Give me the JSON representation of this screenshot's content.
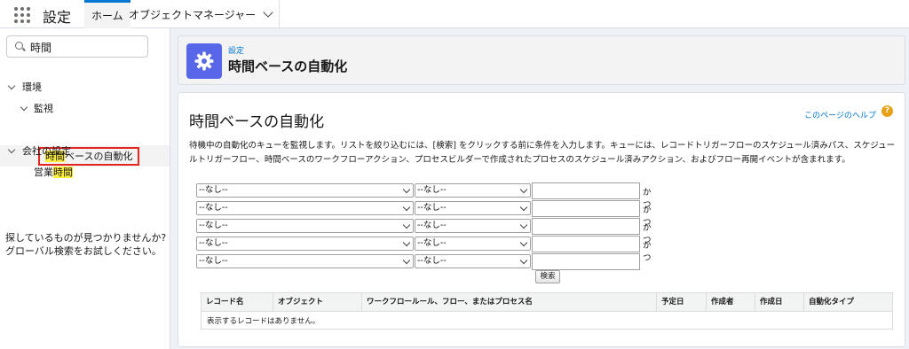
{
  "topbar": {
    "app_title": "設定",
    "tabs": [
      {
        "label": "ホーム",
        "active": true
      },
      {
        "label": "オブジェクトマネージャー",
        "active": false
      }
    ]
  },
  "sidebar": {
    "search": {
      "value": "時間",
      "placeholder": ""
    },
    "tree": {
      "env": "環境",
      "monitor": "監視",
      "selected": {
        "before": "時間",
        "after": "ベースの自動化"
      },
      "company": "会社の設定",
      "business": {
        "before": "営業",
        "match": "時間"
      }
    },
    "help": [
      "探しているものが見つかりませんか?",
      "グローバル検索をお試しください。"
    ]
  },
  "header": {
    "breadcrumb": "設定",
    "title": "時間ベースの自動化"
  },
  "content": {
    "title": "時間ベースの自動化",
    "help_link": "このページのヘルプ",
    "help_icon": "?",
    "description": "待機中の自動化のキューを監視します。リストを絞り込むには、[検索] をクリックする前に条件を入力します。キューには、レコードトリガーフローのスケジュール済みパス、スケジュールトリガーフロー、時間ベースのワークフローアクション、プロセスビルダーで作成されたプロセスのスケジュール済みアクション、およびフロー再開イベントが含まれます。",
    "filters": [
      {
        "field": "--なし--",
        "operator": "--なし--",
        "value": "",
        "conj": "かつ"
      },
      {
        "field": "--なし--",
        "operator": "--なし--",
        "value": "",
        "conj": "かつ"
      },
      {
        "field": "--なし--",
        "operator": "--なし--",
        "value": "",
        "conj": "かつ"
      },
      {
        "field": "--なし--",
        "operator": "--なし--",
        "value": "",
        "conj": "かつ"
      },
      {
        "field": "--なし--",
        "operator": "--なし--",
        "value": "",
        "conj": ""
      }
    ],
    "search_button": "検索",
    "table": {
      "columns": [
        "レコード名",
        "オブジェクト",
        "ワークフロールール、フロー、またはプロセス名",
        "予定日",
        "作成者",
        "作成日",
        "自動化タイプ"
      ],
      "empty_message": "表示するレコードはありません。"
    }
  },
  "colors": {
    "accent": "#0176d3",
    "header_icon": "#5867e8",
    "selection_border": "#e3261f",
    "highlight": "#fff03f",
    "help_icon": "#e8a217"
  },
  "icons": {
    "app_launcher": "waffle-icon",
    "search": "search-icon",
    "header": "gear-icon",
    "help": "help-icon",
    "tree": "chevron-down-icon"
  }
}
